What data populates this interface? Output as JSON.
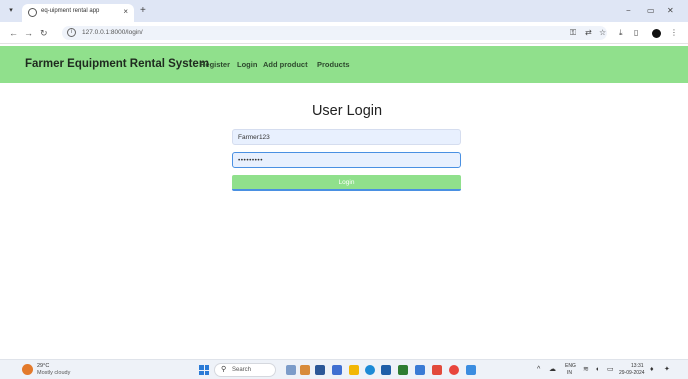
{
  "browser": {
    "tab_title": "eq-uipment rental app",
    "tab_close": "×",
    "new_tab": "+",
    "url": "127.0.0.1:8000/login/",
    "window_controls": {
      "minimize": "−",
      "maximize": "▭",
      "close": "✕"
    }
  },
  "app": {
    "brand": "Farmer Equipment Rental System",
    "nav": [
      {
        "label": "Register"
      },
      {
        "label": "Login"
      },
      {
        "label": "Add product"
      },
      {
        "label": "Products"
      }
    ],
    "accent_color": "#90e08c"
  },
  "login": {
    "title": "User Login",
    "username_value": "Farmer123",
    "password_value": "•••••••••",
    "button_label": "Login"
  },
  "taskbar": {
    "weather_temp": "29°C",
    "weather_desc": "Mostly cloudy",
    "search_placeholder": "Search",
    "lang_top": "ENG",
    "lang_bottom": "IN",
    "time": "13:31",
    "date": "29-09-2024"
  },
  "icons": [
    "chevron-down-icon",
    "favicon-icon",
    "back-icon",
    "forward-icon",
    "reload-icon",
    "site-info-icon",
    "password-key-icon",
    "translate-icon",
    "star-icon",
    "download-icon",
    "sidebar-icon",
    "profile-icon",
    "menu-icon",
    "windows-icon",
    "search-icon"
  ]
}
